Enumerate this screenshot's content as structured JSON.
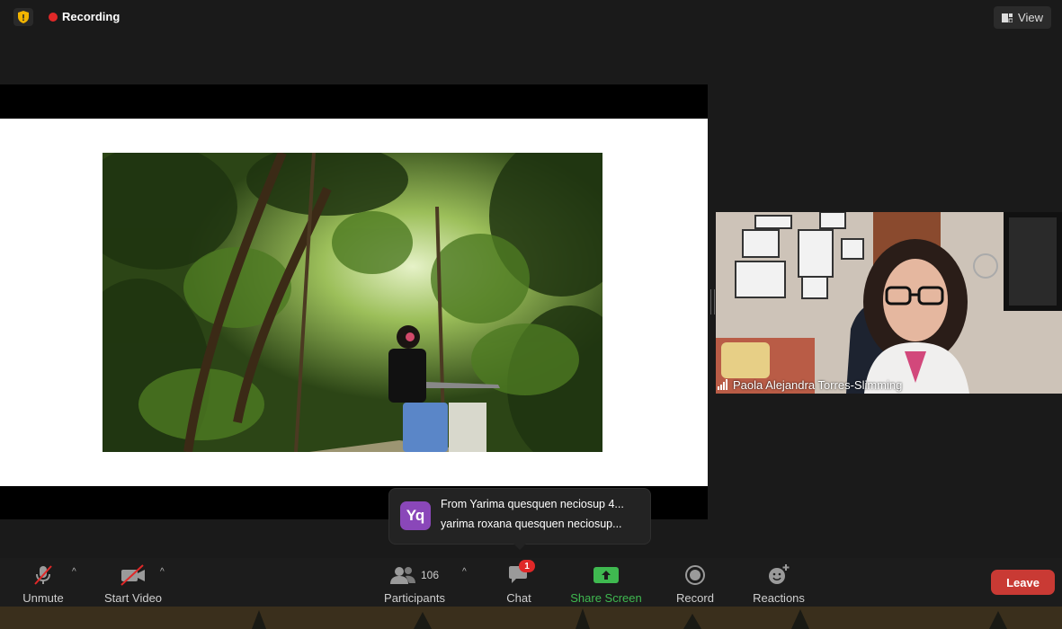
{
  "topbar": {
    "recording_label": "Recording",
    "view_label": "View"
  },
  "video": {
    "participant_name": "Paola Alejandra Torres-Slimming"
  },
  "chat_toast": {
    "avatar_initials": "Yq",
    "line1": "From Yarima quesquen neciosup 4...",
    "line2": "yarima roxana quesquen neciosup..."
  },
  "toolbar": {
    "unmute_label": "Unmute",
    "start_video_label": "Start Video",
    "participants_label": "Participants",
    "participants_count": "106",
    "chat_label": "Chat",
    "chat_badge": "1",
    "share_screen_label": "Share Screen",
    "record_label": "Record",
    "reactions_label": "Reactions",
    "leave_label": "Leave"
  },
  "colors": {
    "recording_dot": "#e02828",
    "share_screen_green": "#3fb950",
    "leave_red": "#c93a34",
    "avatar_purple": "#8a47b9"
  }
}
